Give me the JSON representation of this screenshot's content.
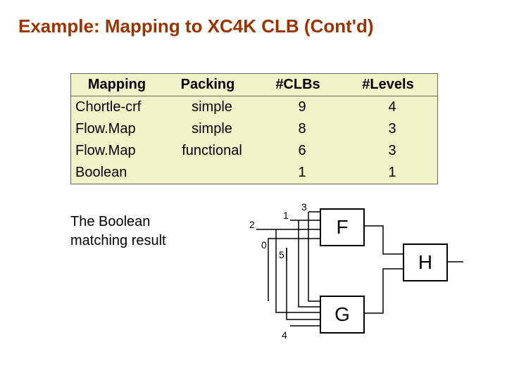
{
  "title": "Example: Mapping to XC4K CLB (Cont'd)",
  "table": {
    "headers": [
      "Mapping",
      "Packing",
      "#CLBs",
      "#Levels"
    ],
    "rows": [
      [
        "Chortle-crf",
        "simple",
        "9",
        "4"
      ],
      [
        "Flow.Map",
        "simple",
        "8",
        "3"
      ],
      [
        "Flow.Map",
        "functional",
        "6",
        "3"
      ],
      [
        "Boolean",
        "",
        "1",
        "1"
      ]
    ]
  },
  "caption_line1": "The Boolean",
  "caption_line2": "matching result",
  "diagram": {
    "signals": {
      "s0": "0",
      "s1": "1",
      "s2": "2",
      "s3": "3",
      "s4": "4",
      "s5": "5"
    },
    "boxes": {
      "F": "F",
      "G": "G",
      "H": "H"
    }
  },
  "chart_data": {
    "type": "table",
    "title": "Mapping to XC4K CLB comparison",
    "columns": [
      "Mapping",
      "Packing",
      "#CLBs",
      "#Levels"
    ],
    "rows": [
      {
        "Mapping": "Chortle-crf",
        "Packing": "simple",
        "#CLBs": 9,
        "#Levels": 4
      },
      {
        "Mapping": "Flow.Map",
        "Packing": "simple",
        "#CLBs": 8,
        "#Levels": 3
      },
      {
        "Mapping": "Flow.Map",
        "Packing": "functional",
        "#CLBs": 6,
        "#Levels": 3
      },
      {
        "Mapping": "Boolean",
        "Packing": "",
        "#CLBs": 1,
        "#Levels": 1
      }
    ]
  }
}
